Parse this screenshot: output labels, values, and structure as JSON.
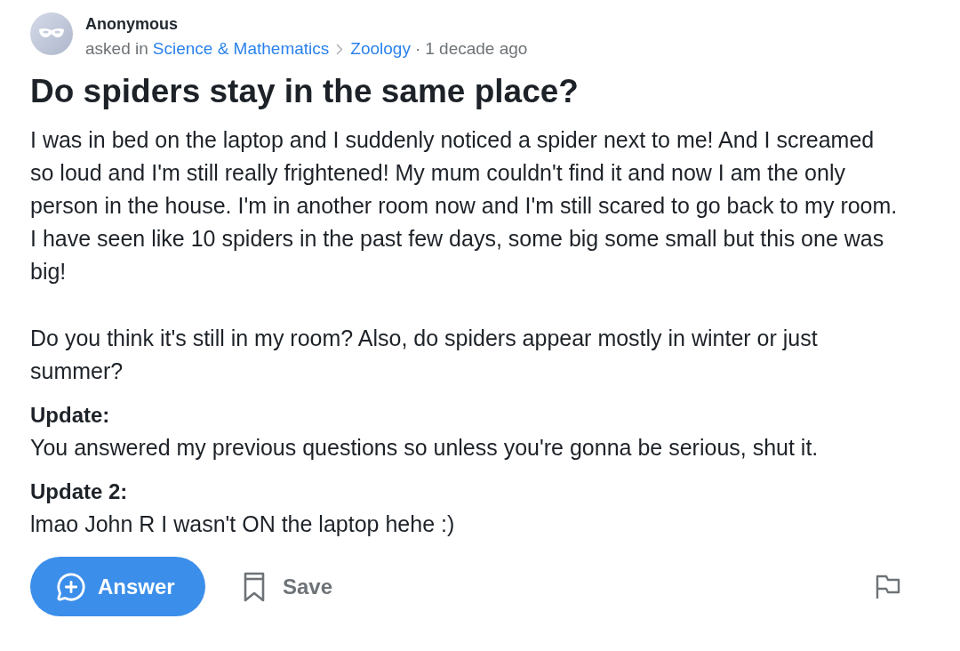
{
  "question": {
    "author": {
      "name": "Anonymous"
    },
    "meta": {
      "prefix": "asked in",
      "category": "Science & Mathematics",
      "subcategory": "Zoology",
      "separator": "·",
      "age": "1 decade ago"
    },
    "title": "Do spiders stay in the same place?",
    "body": [
      "I was in bed on the laptop and I suddenly noticed a spider next to me! And I screamed so loud and I'm still really frightened! My mum couldn't find it and now I am the only person in the house. I'm in another room now and I'm still scared to go back to my room. I have seen like 10 spiders in the past few days, some big some small but this one was big!",
      "Do you think it's still in my room? Also, do spiders appear mostly in winter or just summer?"
    ],
    "updates": [
      {
        "heading": "Update:",
        "text": "You answered my previous questions so unless you're gonna be serious, shut it."
      },
      {
        "heading": "Update 2:",
        "text": "lmao John R I wasn't ON the laptop hehe :)"
      }
    ]
  },
  "actions": {
    "answer": "Answer",
    "save": "Save"
  }
}
